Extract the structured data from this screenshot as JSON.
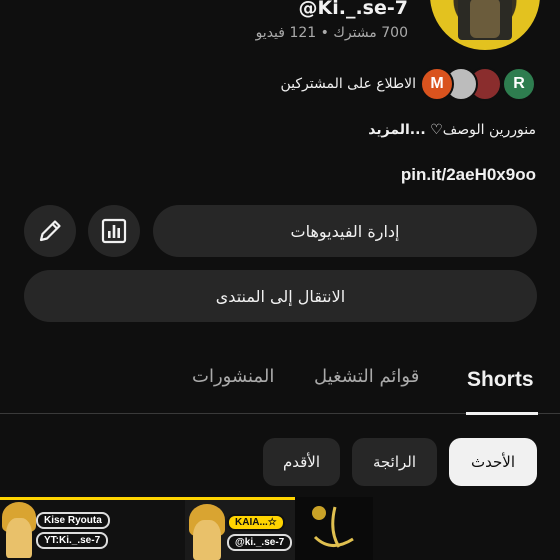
{
  "channel": {
    "handle": "@Ki._.se-7",
    "stats": "700 مشترك • 121 فيديو",
    "subscribers_label": "الاطلاع على المشتركين",
    "subscriber_avatars": [
      {
        "letter": "R",
        "color": "#2e7d4f"
      },
      {
        "letter": "",
        "color": "#8a2d2d"
      },
      {
        "letter": "",
        "color": "#bcbcbc"
      },
      {
        "letter": "M",
        "color": "#d9531e"
      }
    ],
    "description": "منوررين الوصف♡",
    "more_label": "...المزيد",
    "link": "pin.it/2aeH0x9oo"
  },
  "actions": {
    "manage_videos": "إدارة الفيديوهات",
    "community": "الانتقال إلى المنتدى",
    "stats_icon": "bar-chart-icon",
    "edit_icon": "pencil-icon"
  },
  "tabs": [
    {
      "label": "Shorts",
      "active": true
    },
    {
      "label": "قوائم التشغيل",
      "active": false
    },
    {
      "label": "المنشورات",
      "active": false
    }
  ],
  "filters": [
    {
      "label": "الأحدث",
      "active": true
    },
    {
      "label": "الرائجة",
      "active": false
    },
    {
      "label": "الأقدم",
      "active": false
    }
  ],
  "thumbnails": [
    {
      "tag1": "Kise Ryouta",
      "tag2": "YT:Ki._.se-7"
    },
    {
      "tag1": "KAIA...☆",
      "tag2": "@ki._.se-7"
    }
  ]
}
